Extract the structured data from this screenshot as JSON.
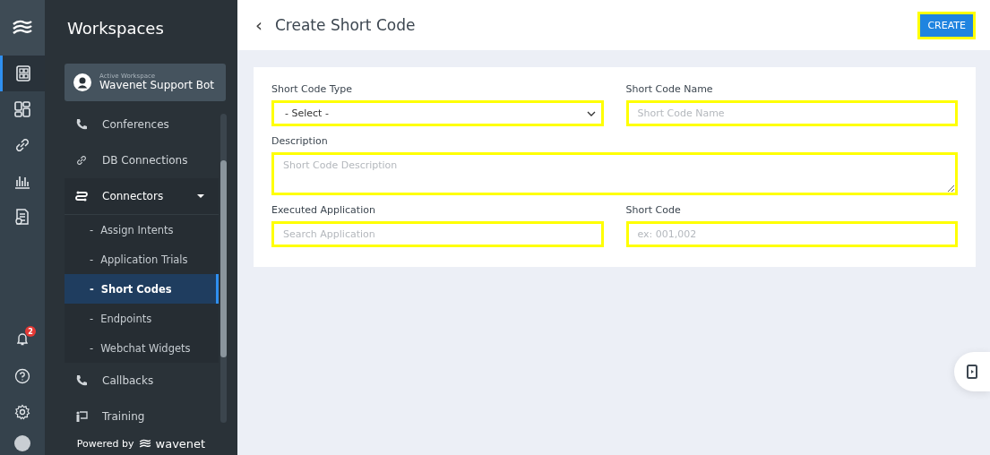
{
  "rail": {
    "items": [
      {
        "selected": true
      },
      {
        "selected": false
      },
      {
        "selected": false
      },
      {
        "selected": false
      },
      {
        "selected": false
      }
    ],
    "notifications": {
      "badge": "2"
    }
  },
  "sidebar": {
    "title": "Workspaces",
    "workspace": {
      "caption": "Active Workspace",
      "name": "Wavenet Support Bot"
    },
    "items": [
      {
        "label": "Conferences",
        "selected": false
      },
      {
        "label": "DB Connections",
        "selected": false
      },
      {
        "label": "Connectors",
        "selected": false,
        "expanded": true,
        "children": [
          {
            "bullet": "-",
            "label": "Assign Intents",
            "selected": false
          },
          {
            "bullet": "-",
            "label": "Application Trials",
            "selected": false
          },
          {
            "bullet": "-",
            "label": "Short Codes",
            "selected": true
          },
          {
            "bullet": "-",
            "label": "Endpoints",
            "selected": false
          },
          {
            "bullet": "-",
            "label": "Webchat Widgets",
            "selected": false
          }
        ]
      },
      {
        "label": "Callbacks",
        "selected": false
      },
      {
        "label": "Training",
        "selected": false
      }
    ],
    "footer": {
      "prefix": "Powered by",
      "brand": "wavenet"
    }
  },
  "header": {
    "back": "‹",
    "title": "Create Short Code",
    "button": "CREATE"
  },
  "form": {
    "rows": [
      [
        {
          "kind": "select",
          "label": "Short Code Type",
          "value": "- Select -"
        },
        {
          "kind": "input",
          "label": "Short Code Name",
          "placeholder": "Short Code Name"
        }
      ],
      [
        {
          "kind": "textarea",
          "label": "Description",
          "placeholder": "Short Code Description"
        }
      ],
      [
        {
          "kind": "input",
          "label": "Executed Application",
          "placeholder": "Search Application"
        },
        {
          "kind": "input",
          "label": "Short Code",
          "placeholder": "ex: 001,002"
        }
      ]
    ]
  }
}
